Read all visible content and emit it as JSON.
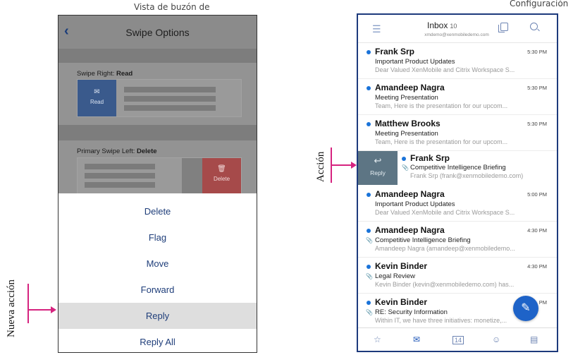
{
  "captions": {
    "left_top": "Vista de buzón de",
    "right_top": "Configuración",
    "new_action": "Nueva acción",
    "action": "Acción"
  },
  "swipe_options": {
    "title": "Swipe Options",
    "swipe_right_label": "Swipe Right:",
    "swipe_right_value": "Read",
    "read_button": "Read",
    "primary_left_label": "Primary Swipe Left:",
    "primary_left_value": "Delete",
    "delete_button": "Delete",
    "sheet_items": [
      "Delete",
      "Flag",
      "Move",
      "Forward",
      "Reply",
      "Reply All"
    ],
    "highlighted_item": "Reply"
  },
  "inbox": {
    "title": "Inbox",
    "count": "10",
    "account": "xmdemo@xenmobiledemo.com",
    "messages": [
      {
        "from": "Frank Srp",
        "time": "5:30 PM",
        "subject": "Important Product Updates",
        "preview": "Dear Valued XenMobile and Citrix Workspace S..."
      },
      {
        "from": "Amandeep Nagra",
        "time": "5:30 PM",
        "subject": "Meeting Presentation",
        "preview": "Team,   Here is the presentation for our upcom..."
      },
      {
        "from": "Matthew Brooks",
        "time": "5:30 PM",
        "subject": "Meeting Presentation",
        "preview": "Team,   Here is the presentation for our upcom..."
      },
      {
        "from": "Frank Srp",
        "time": "",
        "subject": "Competitive Intelligence Briefing",
        "preview": "Frank Srp (frank@xenmobiledemo.com)"
      },
      {
        "from": "Amandeep Nagra",
        "time": "5:00 PM",
        "subject": "Important Product Updates",
        "preview": "Dear Valued XenMobile and Citrix Workspace S..."
      },
      {
        "from": "Amandeep Nagra",
        "time": "4:30 PM",
        "subject": "Competitive Intelligence Briefing",
        "preview": "Amandeep Nagra (amandeep@xenmobiledemo..."
      },
      {
        "from": "Kevin Binder",
        "time": "4:30 PM",
        "subject": "Legal Review",
        "preview": "Kevin Binder (kevin@xenmobiledemo.com) has..."
      },
      {
        "from": "Kevin Binder",
        "time": "PM",
        "subject": "RE: Security Information",
        "preview": "Within IT, we have three initiatives: monetize,..."
      }
    ],
    "reply_label": "Reply",
    "tabbar_icons": [
      "favorites-icon",
      "mail-icon",
      "calendar-icon",
      "contacts-icon",
      "notes-icon"
    ],
    "calendar_day": "14"
  },
  "colors": {
    "accent_arrow": "#d6237f",
    "inbox_border": "#1d3a7c",
    "unread_dot": "#1a73d9",
    "reply_swipe": "#5d7584"
  }
}
